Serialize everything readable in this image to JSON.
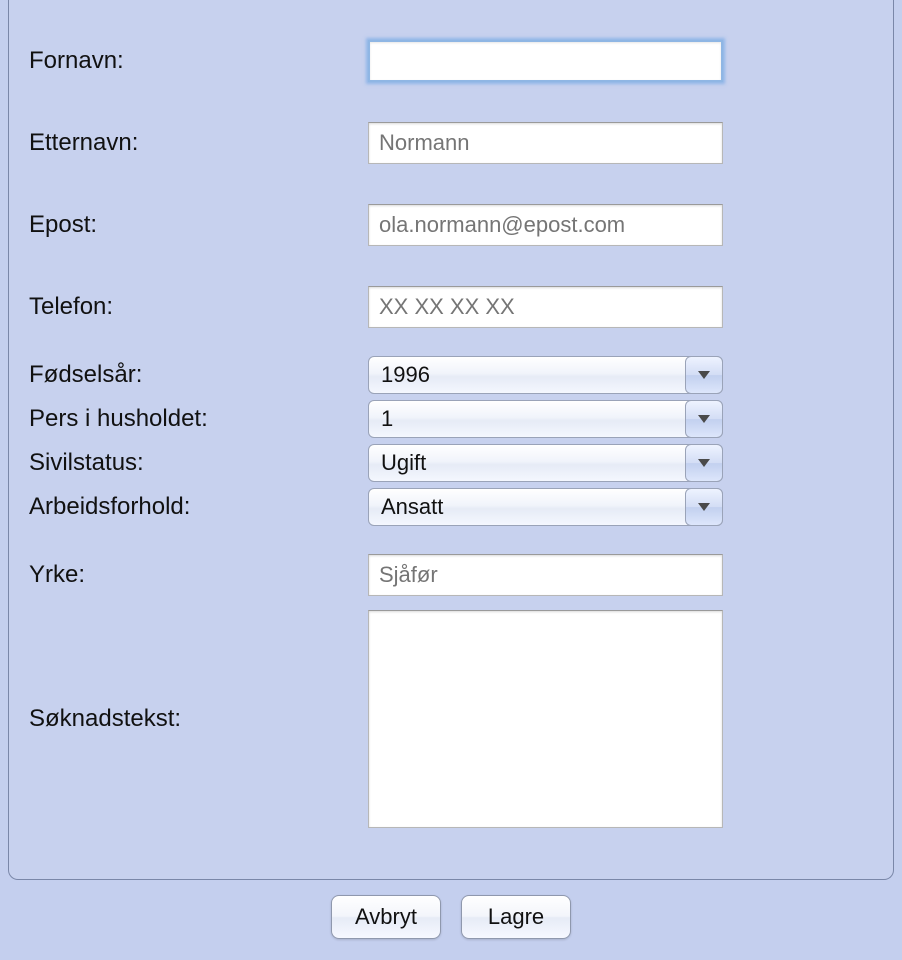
{
  "form": {
    "fornavn": {
      "label": "Fornavn:",
      "value": "",
      "placeholder": ""
    },
    "etternavn": {
      "label": "Etternavn:",
      "value": "",
      "placeholder": "Normann"
    },
    "epost": {
      "label": "Epost:",
      "value": "",
      "placeholder": "ola.normann@epost.com"
    },
    "telefon": {
      "label": "Telefon:",
      "value": "",
      "placeholder": "XX XX XX XX"
    },
    "fodselsar": {
      "label": "Fødselsår:",
      "value": "1996"
    },
    "pers_hushold": {
      "label": "Pers i husholdet:",
      "value": "1"
    },
    "sivilstatus": {
      "label": "Sivilstatus:",
      "value": "Ugift"
    },
    "arbeidsforhold": {
      "label": "Arbeidsforhold:",
      "value": "Ansatt"
    },
    "yrke": {
      "label": "Yrke:",
      "value": "",
      "placeholder": "Sjåfør"
    },
    "soknadstekst": {
      "label": "Søknadstekst:",
      "value": ""
    }
  },
  "buttons": {
    "cancel": "Avbryt",
    "save": "Lagre"
  }
}
